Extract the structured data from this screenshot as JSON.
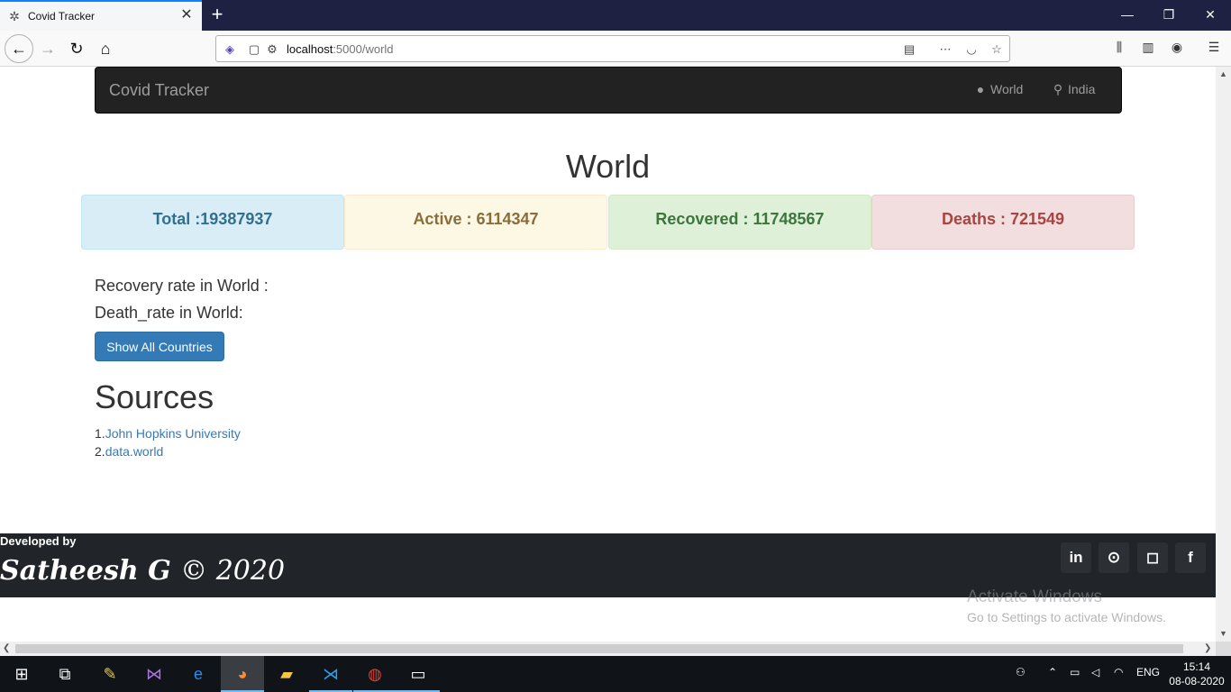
{
  "browser": {
    "tab_title": "Covid Tracker",
    "tab_icon": "virus-icon",
    "close_glyph": "✕",
    "new_tab_glyph": "+",
    "url_host": "localhost",
    "url_path": ":5000/world",
    "window_controls": {
      "minimize": "—",
      "restore": "❐",
      "close": "✕"
    }
  },
  "app": {
    "brand": "Covid Tracker",
    "nav": [
      {
        "label": "World",
        "icon": "globe-icon"
      },
      {
        "label": "India",
        "icon": "map-marker-icon"
      }
    ]
  },
  "main": {
    "title": "World",
    "stats": {
      "total": "Total :19387937",
      "active": "Active : 6114347",
      "recovered": "Recovered : 11748567",
      "deaths": "Deaths : 721549"
    },
    "recovery_rate_label": "Recovery rate in World :",
    "death_rate_label": "Death_rate in World:",
    "show_all_button": "Show All Countries",
    "sources_title": "Sources",
    "sources": [
      {
        "prefix": "1.",
        "label": "John Hopkins University"
      },
      {
        "prefix": "2.",
        "label": "data.world"
      }
    ]
  },
  "footer": {
    "developed_by": "Developed by",
    "developer": "Satheesh G",
    "copyright": "© 2020",
    "social": [
      {
        "icon": "linkedin-icon",
        "glyph": "in"
      },
      {
        "icon": "github-icon",
        "glyph": "⊙"
      },
      {
        "icon": "instagram-icon",
        "glyph": "◻"
      },
      {
        "icon": "facebook-icon",
        "glyph": "f"
      }
    ]
  },
  "watermark": {
    "line1": "Activate Windows",
    "line2": "Go to Settings to activate Windows."
  },
  "taskbar": {
    "language": "ENG",
    "time": "15:14",
    "date": "08-08-2020"
  }
}
